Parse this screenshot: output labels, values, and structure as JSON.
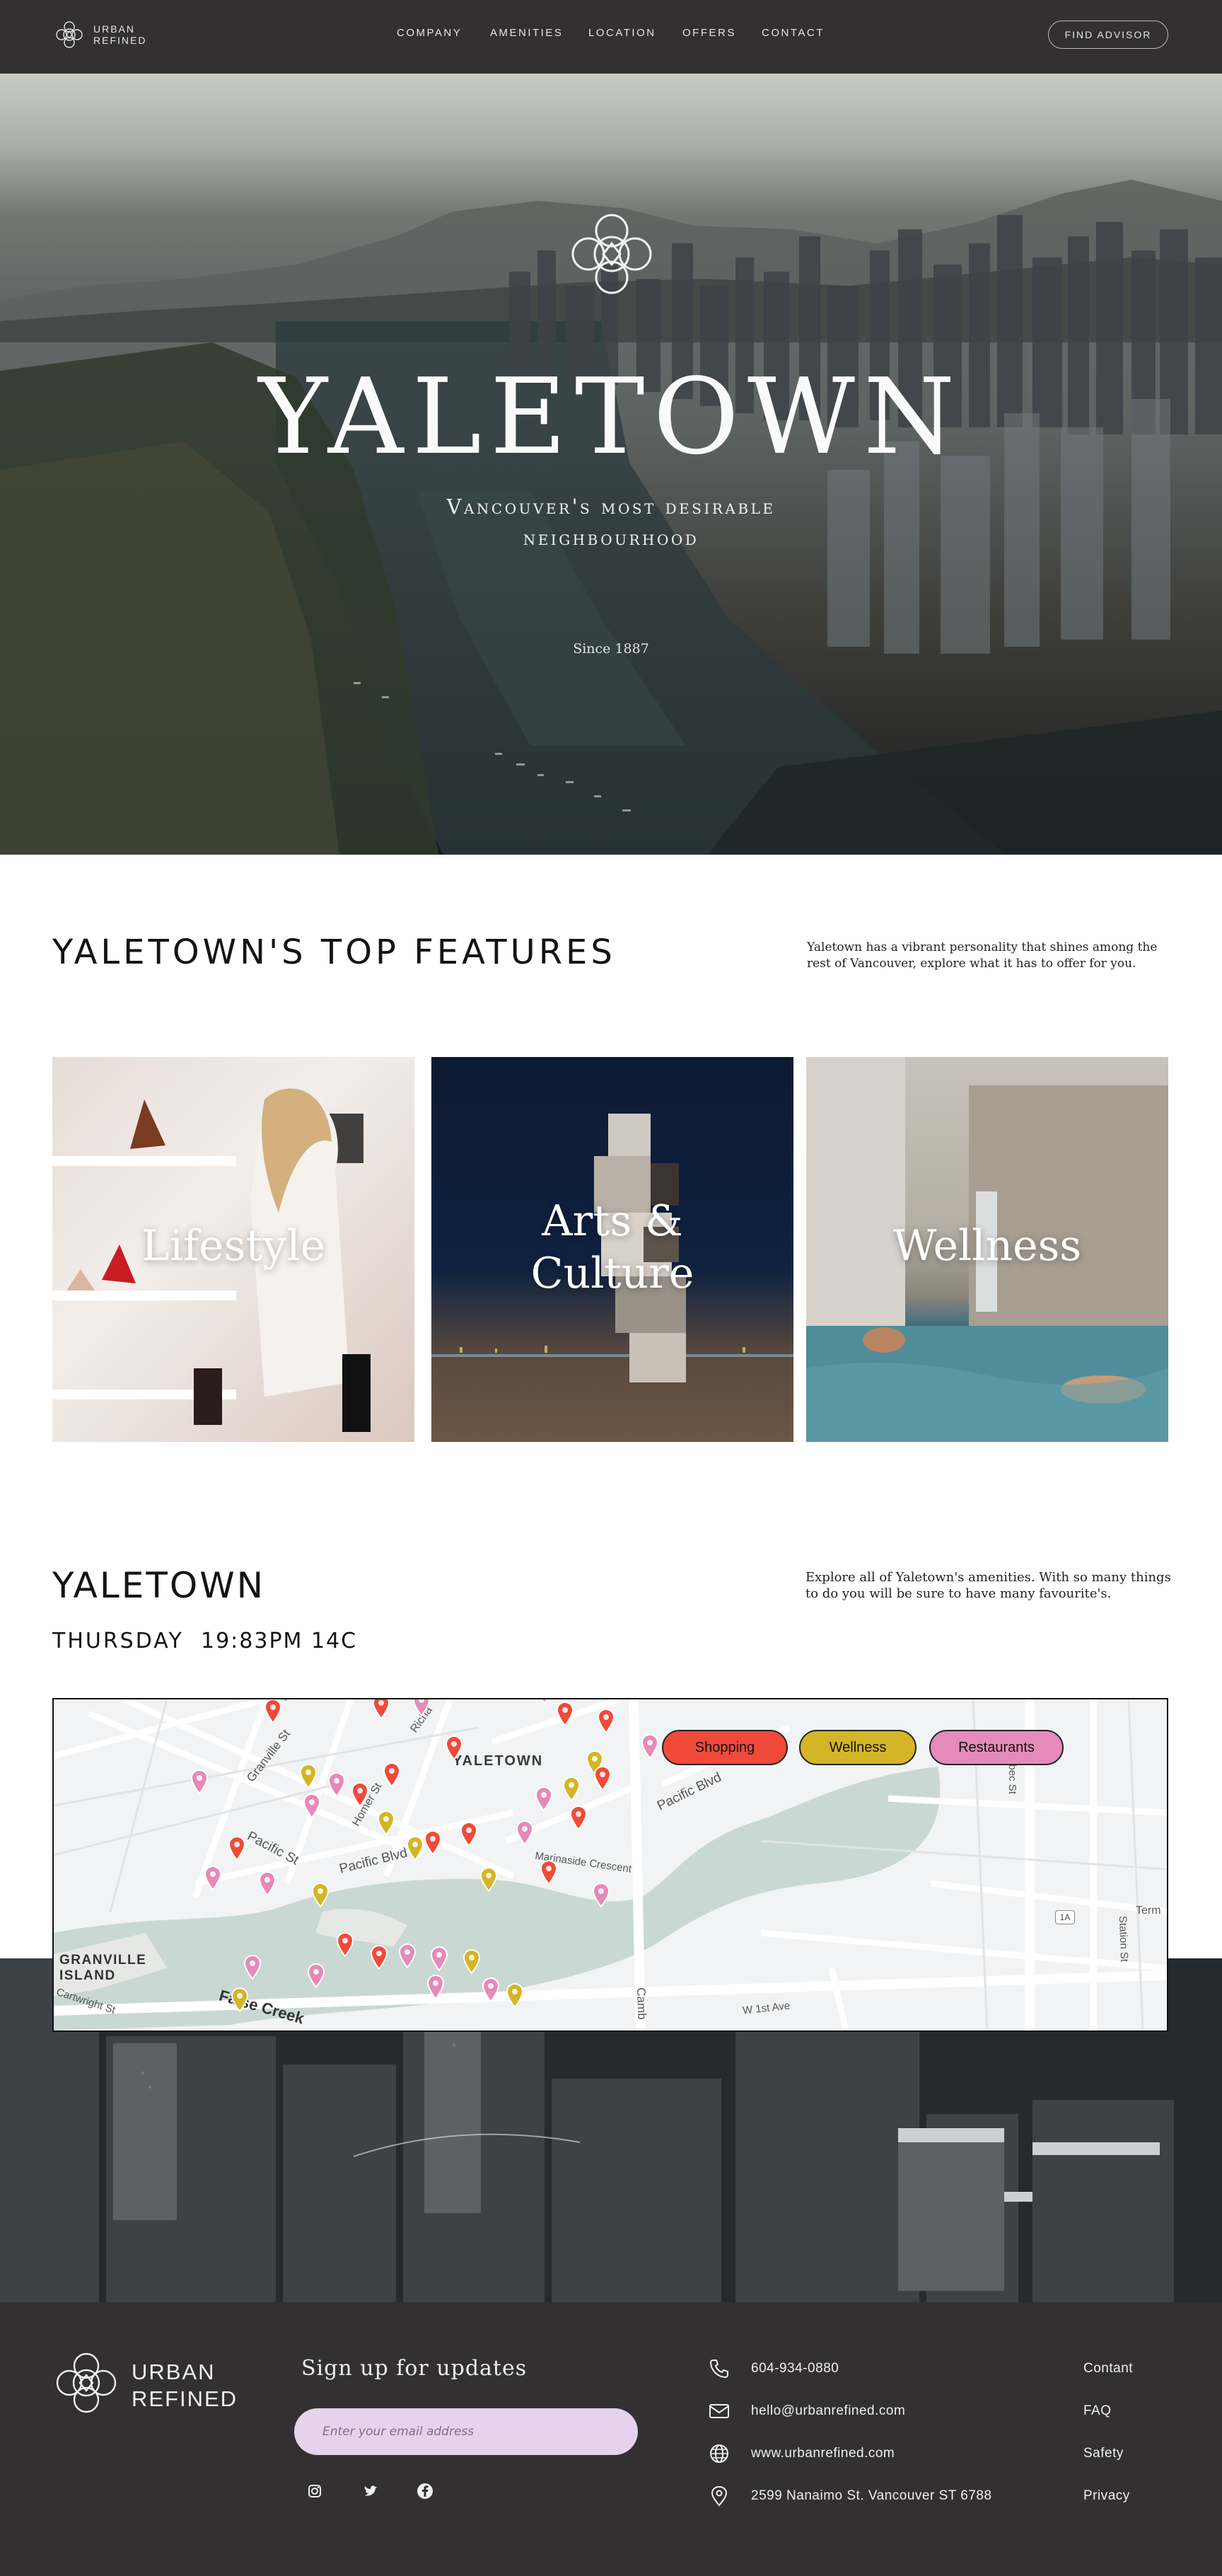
{
  "brand": {
    "line1": "URBAN",
    "line2": "REFINED"
  },
  "nav": {
    "links": [
      "COMPANY",
      "AMENITIES",
      "LOCATION",
      "OFFERS",
      "CONTACT"
    ],
    "cta": "FIND ADVISOR"
  },
  "hero": {
    "title": "YALETOWN",
    "subtitle": "Vancouver's most desirable neighbourhood",
    "since": "Since 1887"
  },
  "features": {
    "title": "YALETOWN'S TOP FEATURES",
    "description": "Yaletown has a vibrant personality that shines among the rest of Vancouver, explore what it has to offer for you.",
    "cards": [
      {
        "label": "Lifestyle"
      },
      {
        "label_line1": "Arts &",
        "label_line2": "Culture"
      },
      {
        "label": "Wellness"
      }
    ]
  },
  "yaletown": {
    "title": "YALETOWN",
    "day": "THURSDAY",
    "time_weather": "19:83PM 14C",
    "description": "Explore all of Yaletown's amenities. With so many things to do you will be sure to have many favourite's."
  },
  "map": {
    "filters": [
      {
        "label": "Shopping",
        "color": "#f04a3a"
      },
      {
        "label": "Wellness",
        "color": "#d4b526"
      },
      {
        "label": "Restaurants",
        "color": "#e58ab9"
      }
    ],
    "labels": {
      "yaletown": "YALETOWN",
      "granville_island_1": "GRANVILLE",
      "granville_island_2": "ISLAND",
      "false_creek": "False Creek",
      "pacific_blvd_1": "Pacific Blvd",
      "pacific_blvd_2": "Pacific Blvd",
      "pacific_st": "Pacific St",
      "marinaside": "Marinaside Crescent",
      "granville_st": "Granville St",
      "cambie": "Camb",
      "w1st": "W 1st Ave",
      "cartwright": "Cartwright St",
      "quebec_st": "ebec St",
      "station_st": "Station St",
      "term": "Term",
      "homer": "Homer St",
      "richards": "Richa",
      "route": "1A"
    }
  },
  "footer": {
    "signup_title": "Sign up for updates",
    "email_placeholder": "Enter your email address",
    "contact": {
      "phone": "604-934-0880",
      "email": "hello@urbanrefined.com",
      "website": "www.urbanrefined.com",
      "address": "2599 Nanaimo St. Vancouver ST 6788"
    },
    "links": [
      "Contant",
      "FAQ",
      "Safety",
      "Privacy"
    ]
  },
  "colors": {
    "dark": "#323030",
    "shopping": "#f04a3a",
    "wellness": "#d4b526",
    "restaurants": "#e58ab9",
    "input_bg": "#e6d2ec"
  }
}
